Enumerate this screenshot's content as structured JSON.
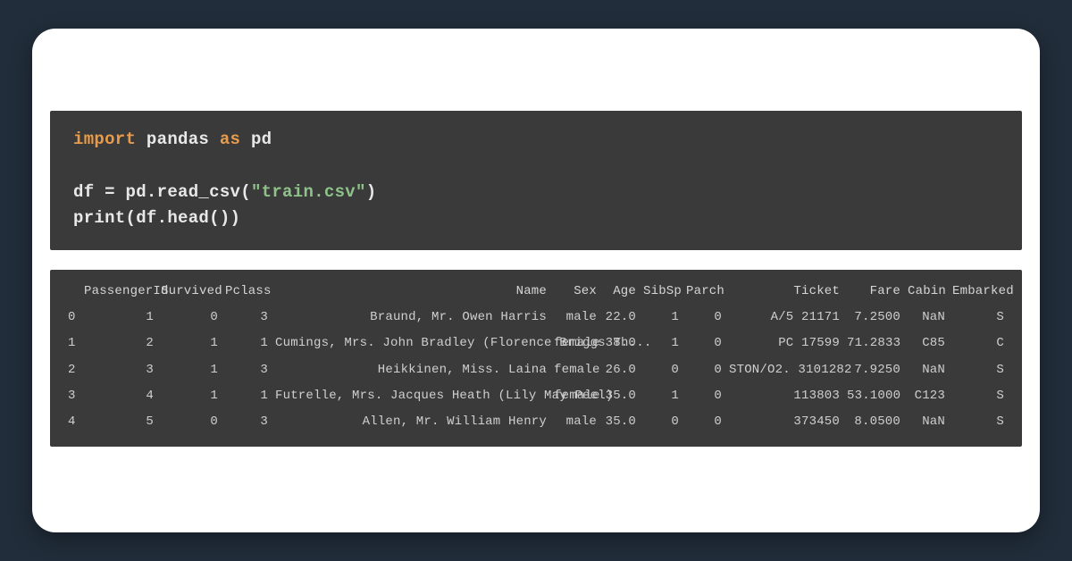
{
  "code": {
    "kw_import": "import",
    "mod": "pandas",
    "kw_as": "as",
    "alias": "pd",
    "blank": "",
    "assign_lhs": "df ",
    "eq": "= ",
    "call1": "pd.read_csv(",
    "str_arg": "\"train.csv\"",
    "call1_close": ")",
    "print_open": "print",
    "print_args": "(df.head())"
  },
  "output": {
    "headers": {
      "idx": "",
      "pid": "PassengerId",
      "surv": "Survived",
      "pcl": "Pclass",
      "name": "Name",
      "sex": "Sex",
      "age": "Age",
      "sib": "SibSp",
      "par": "Parch",
      "tick": "Ticket",
      "fare": "Fare",
      "cab": "Cabin",
      "emb": "Embarked"
    },
    "rows": [
      {
        "idx": "0",
        "pid": "1",
        "surv": "0",
        "pcl": "3",
        "name": "Braund, Mr. Owen Harris",
        "sex": "male",
        "age": "22.0",
        "sib": "1",
        "par": "0",
        "tick": "A/5 21171",
        "fare": "7.2500",
        "cab": "NaN",
        "emb": "S"
      },
      {
        "idx": "1",
        "pid": "2",
        "surv": "1",
        "pcl": "1",
        "name": "Cumings, Mrs. John Bradley (Florence Briggs Th...",
        "sex": "female",
        "age": "38.0",
        "sib": "1",
        "par": "0",
        "tick": "PC 17599",
        "fare": "71.2833",
        "cab": "C85",
        "emb": "C"
      },
      {
        "idx": "2",
        "pid": "3",
        "surv": "1",
        "pcl": "3",
        "name": "Heikkinen, Miss. Laina",
        "sex": "female",
        "age": "26.0",
        "sib": "0",
        "par": "0",
        "tick": "STON/O2. 3101282",
        "fare": "7.9250",
        "cab": "NaN",
        "emb": "S"
      },
      {
        "idx": "3",
        "pid": "4",
        "surv": "1",
        "pcl": "1",
        "name": "Futrelle, Mrs. Jacques Heath (Lily May Peel)",
        "sex": "female",
        "age": "35.0",
        "sib": "1",
        "par": "0",
        "tick": "113803",
        "fare": "53.1000",
        "cab": "C123",
        "emb": "S"
      },
      {
        "idx": "4",
        "pid": "5",
        "surv": "0",
        "pcl": "3",
        "name": "Allen, Mr. William Henry",
        "sex": "male",
        "age": "35.0",
        "sib": "0",
        "par": "0",
        "tick": "373450",
        "fare": "8.0500",
        "cab": "NaN",
        "emb": "S"
      }
    ]
  },
  "chart_data": {
    "type": "table",
    "title": "",
    "columns": [
      "PassengerId",
      "Survived",
      "Pclass",
      "Name",
      "Sex",
      "Age",
      "SibSp",
      "Parch",
      "Ticket",
      "Fare",
      "Cabin",
      "Embarked"
    ],
    "index": [
      0,
      1,
      2,
      3,
      4
    ],
    "data": [
      [
        1,
        0,
        3,
        "Braund, Mr. Owen Harris",
        "male",
        22.0,
        1,
        0,
        "A/5 21171",
        7.25,
        "NaN",
        "S"
      ],
      [
        2,
        1,
        1,
        "Cumings, Mrs. John Bradley (Florence Briggs Th...",
        "female",
        38.0,
        1,
        0,
        "PC 17599",
        71.2833,
        "C85",
        "C"
      ],
      [
        3,
        1,
        3,
        "Heikkinen, Miss. Laina",
        "female",
        26.0,
        0,
        0,
        "STON/O2. 3101282",
        7.925,
        "NaN",
        "S"
      ],
      [
        4,
        1,
        1,
        "Futrelle, Mrs. Jacques Heath (Lily May Peel)",
        "female",
        35.0,
        1,
        0,
        "113803",
        53.1,
        "C123",
        "S"
      ],
      [
        5,
        0,
        3,
        "Allen, Mr. William Henry",
        "male",
        35.0,
        0,
        0,
        "373450",
        8.05,
        "NaN",
        "S"
      ]
    ]
  }
}
